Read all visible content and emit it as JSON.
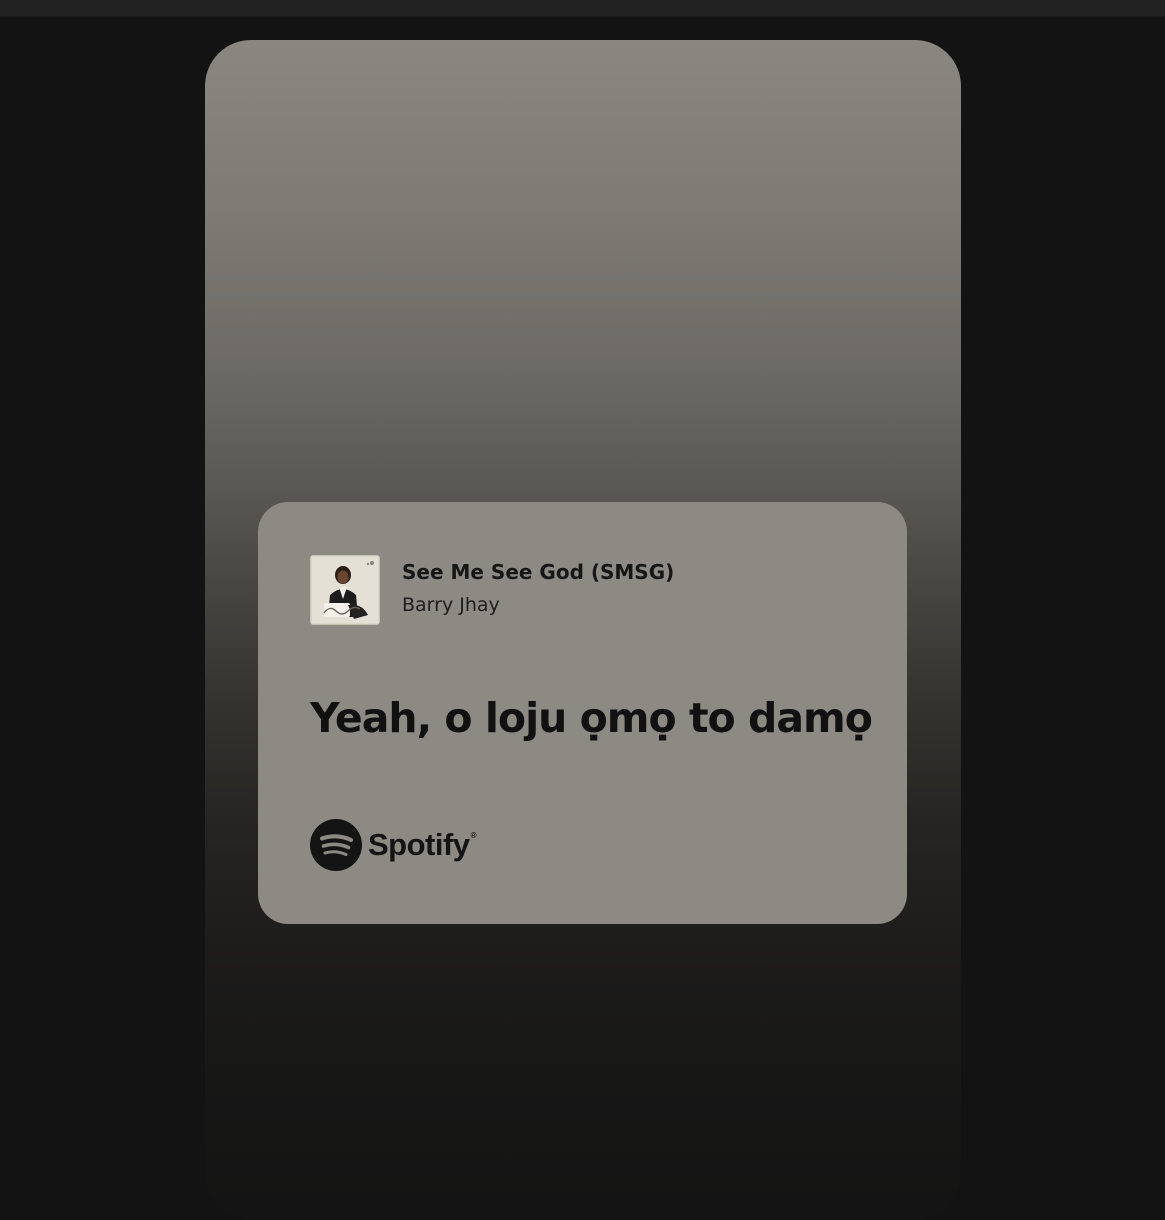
{
  "track": {
    "title": "See Me See God (SMSG)",
    "artist": "Barry Jhay"
  },
  "lyric": {
    "line": "Yeah, o loju ọmọ to damọ"
  },
  "brand": {
    "name": "Spotify",
    "registered_mark": "®",
    "icon": "spotify-logo-icon"
  },
  "album_art": {
    "script_text": "Barry Jhay"
  },
  "colors": {
    "page_background": "#131313",
    "card_background": "#8d8a83",
    "text": "#161616"
  }
}
